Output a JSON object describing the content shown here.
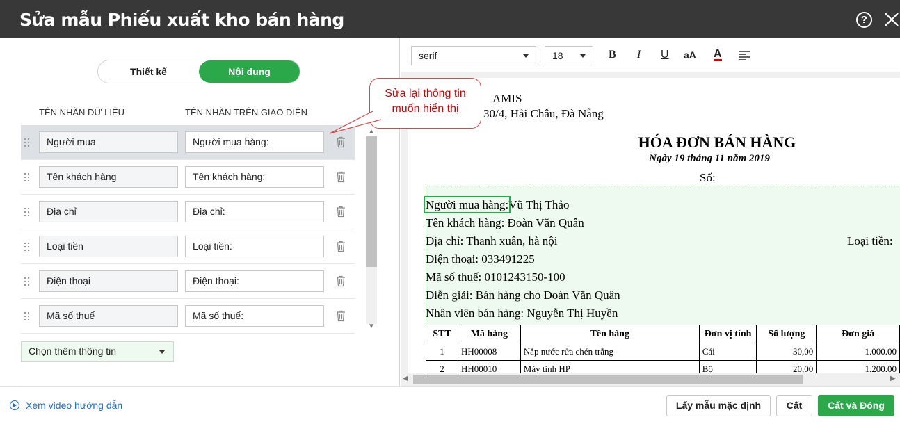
{
  "window": {
    "title": "Sửa mẫu Phiếu xuất kho bán hàng",
    "help_icon_text": "?"
  },
  "mode_toggle": {
    "design_label": "Thiết kế",
    "content_label": "Nội dung",
    "selected": "Nội dung"
  },
  "columns": {
    "data_label_header": "TÊN NHÃN DỮ LIỆU",
    "ui_label_header": "TÊN NHÃN TRÊN GIAO DIỆN"
  },
  "rows": [
    {
      "data_label": "Người mua",
      "ui_label": "Người mua hàng:"
    },
    {
      "data_label": "Tên khách hàng",
      "ui_label": "Tên khách hàng:"
    },
    {
      "data_label": "Địa chỉ",
      "ui_label": "Địa chỉ:"
    },
    {
      "data_label": "Loại tiền",
      "ui_label": "Loại tiền:"
    },
    {
      "data_label": "Điện thoại",
      "ui_label": "Điện thoại:"
    },
    {
      "data_label": "Mã số thuế",
      "ui_label": "Mã số thuế:"
    }
  ],
  "more_info_select": {
    "label": "Chọn thêm thông tin"
  },
  "callout": {
    "line1": "Sửa lại thông tin",
    "line2": "muốn hiển thị"
  },
  "editor_toolbar": {
    "font": "serif",
    "size": "18",
    "bold": "B",
    "italic": "I",
    "underline": "U",
    "case": "aA",
    "color": "A"
  },
  "preview": {
    "header_line1": "AMIS",
    "header_line2": "30/4, Hải Châu, Đà Nẵng",
    "title": "HÓA ĐƠN BÁN HÀNG",
    "date": "Ngày 19 tháng 11 năm 2019",
    "number_label": "Số:",
    "buyer_label": "Người mua hàng:",
    "buyer_value": "Vũ Thị Thảo",
    "customer": "Tên khách hàng: Đoàn Văn Quân",
    "address": "Địa chỉ: Thanh xuân, hà nội",
    "currency": "Loại tiền:",
    "phone": "Điện thoại: 033491225",
    "tax_code": "Mã số thuế: 0101243150-100",
    "description": "Diễn giải: Bán hàng cho Đoàn Văn Quân",
    "salesperson": "Nhân viên bán hàng: Nguyễn Thị Huyền",
    "table": {
      "headers": [
        "STT",
        "Mã hàng",
        "Tên hàng",
        "Đơn vị tính",
        "Số lượng",
        "Đơn giá"
      ],
      "rows": [
        [
          "1",
          "HH00008",
          "Nắp nước rửa chén trắng",
          "Cái",
          "30,00",
          "1.000.00"
        ],
        [
          "2",
          "HH00010",
          "Máy tính HP",
          "Bộ",
          "20,00",
          "1.200.00"
        ]
      ]
    }
  },
  "footer": {
    "video_link": "Xem video hướng dẫn",
    "default_button": "Lấy mẫu mặc định",
    "save_button": "Cất",
    "save_close_button": "Cất và Đóng"
  },
  "colors": {
    "accent": "#2aa84a",
    "titlebar": "#383838",
    "callout_text": "#d40000",
    "link": "#1f6fd1"
  }
}
